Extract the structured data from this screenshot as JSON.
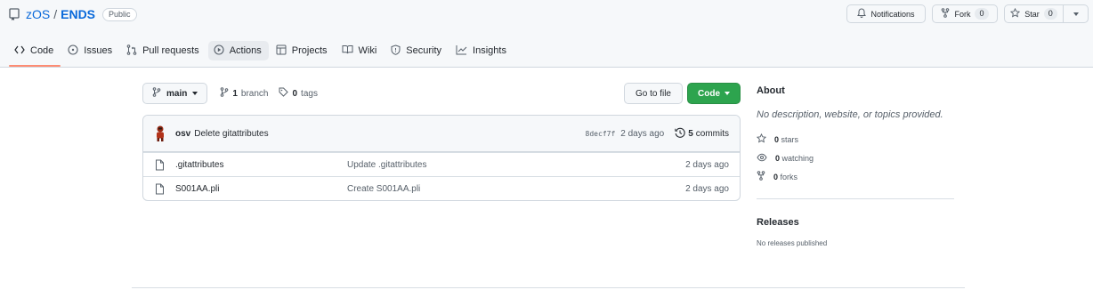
{
  "repo": {
    "owner": "zOS",
    "separator": "/",
    "name": "ENDS",
    "visibility": "Public"
  },
  "header_actions": {
    "notifications_label": "Notifications",
    "fork_label": "Fork",
    "fork_count": "0",
    "star_label": "Star",
    "star_count": "0"
  },
  "tabs": [
    {
      "label": "Code",
      "icon": "code-icon",
      "selected": true
    },
    {
      "label": "Issues",
      "icon": "issue-icon"
    },
    {
      "label": "Pull requests",
      "icon": "pull-request-icon"
    },
    {
      "label": "Actions",
      "icon": "play-icon"
    },
    {
      "label": "Projects",
      "icon": "table-icon"
    },
    {
      "label": "Wiki",
      "icon": "book-icon"
    },
    {
      "label": "Security",
      "icon": "shield-icon"
    },
    {
      "label": "Insights",
      "icon": "graph-icon"
    }
  ],
  "file_nav": {
    "branch": "main",
    "branch_count": "1",
    "branch_word": "branch",
    "tag_count": "0",
    "tag_word": "tags",
    "goto_file": "Go to file",
    "code_button": "Code"
  },
  "latest_commit": {
    "author": "osv",
    "message": "Delete gitattributes",
    "sha": "8decf7f",
    "ago": "2 days ago",
    "commit_count": "5",
    "commit_word": "commits"
  },
  "files": [
    {
      "name": ".gitattributes",
      "message": "Update .gitattributes",
      "age": "2 days ago"
    },
    {
      "name": "S001AA.pli",
      "message": "Create S001AA.pli",
      "age": "2 days ago"
    }
  ],
  "about": {
    "heading": "About",
    "description": "No description, website, or topics provided.",
    "stars_count": "0",
    "stars_word": "stars",
    "watching_count": "0",
    "watching_word": "watching",
    "forks_count": "0",
    "forks_word": "forks"
  },
  "releases": {
    "heading": "Releases",
    "empty_text": "No releases published"
  },
  "colors": {
    "accent_blue": "#0969da",
    "code_button_green": "#2da44e",
    "selected_tab_underline": "#fd8c73"
  }
}
